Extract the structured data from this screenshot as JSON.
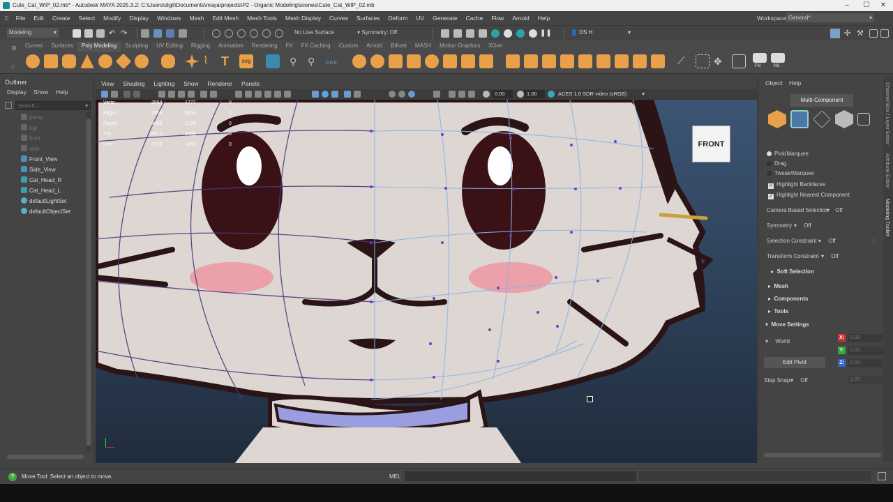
{
  "titlebar": {
    "title": "Cute_Cat_WIP_02.mb* - Autodesk MAYA 2025.3.2: C:\\Users\\digit\\Documents\\maya\\projects\\P2 - Organic Modeling\\scenes\\Cute_Cat_WIP_02.mb"
  },
  "menubar": {
    "items": [
      "File",
      "Edit",
      "Create",
      "Select",
      "Modify",
      "Display",
      "Windows",
      "Mesh",
      "Edit Mesh",
      "Mesh Tools",
      "Mesh Display",
      "Curves",
      "Surfaces",
      "Deform",
      "UV",
      "Generate",
      "Cache",
      "Flow",
      "Arnold",
      "Help"
    ],
    "workspace_label": "Workspace:",
    "workspace_value": "General*"
  },
  "statusline": {
    "menuset": "Modeling",
    "live_surface": "No Live Surface",
    "symmetry": "Symmetry: Off",
    "user": "DS H"
  },
  "shelf": {
    "tabs": [
      "Curves",
      "Surfaces",
      "Poly Modeling",
      "Sculpting",
      "UV Editing",
      "Rigging",
      "Animation",
      "Rendering",
      "FX",
      "FX Caching",
      "Custom",
      "Arnold",
      "Bifrost",
      "MASH",
      "Motion Graphics",
      "XGen"
    ],
    "active_tab": "Poly Modeling",
    "icon_labels": {
      "fn": "FN",
      "ns": "NS",
      "num": "0.0.0"
    }
  },
  "outliner": {
    "title": "Outliner",
    "menu": [
      "Display",
      "Show",
      "Help"
    ],
    "search_placeholder": "Search...",
    "items": [
      {
        "label": "persp",
        "dim": true
      },
      {
        "label": "top",
        "dim": true
      },
      {
        "label": "front",
        "dim": true
      },
      {
        "label": "side",
        "dim": true
      },
      {
        "label": "Front_View",
        "dim": false
      },
      {
        "label": "Side_View",
        "dim": false
      },
      {
        "label": "Cat_Head_R",
        "dim": false
      },
      {
        "label": "Cat_Head_L",
        "dim": false
      },
      {
        "label": "defaultLightSet",
        "dim": false
      },
      {
        "label": "defaultObjectSet",
        "dim": false
      }
    ]
  },
  "viewport": {
    "menu": [
      "View",
      "Shading",
      "Lighting",
      "Show",
      "Renderer",
      "Panels"
    ],
    "exposure": "0.00",
    "gamma": "1.00",
    "colorspace": "ACES 1.0 SDR-video (sRGB)",
    "camera_label": "front -Z",
    "view_cube": "FRONT",
    "hud": [
      {
        "label": "Verts:",
        "a": "3554",
        "b": "1777",
        "c": "0"
      },
      {
        "label": "Edges:",
        "a": "7008",
        "b": "3504",
        "c": "0"
      },
      {
        "label": "Faces:",
        "a": "3456",
        "b": "1728",
        "c": "0"
      },
      {
        "label": "Tris:",
        "a": "6912",
        "b": "3456",
        "c": "0"
      },
      {
        "label": "UVs:",
        "a": "3722",
        "b": "1861",
        "c": "0"
      }
    ]
  },
  "modeling_toolkit": {
    "tabs": [
      "Object",
      "Help"
    ],
    "mode": "Multi-Component",
    "pick_marquee": "Pick/Marquee",
    "drag": "Drag",
    "tweak_marquee": "Tweak/Marquee",
    "highlight_backfaces": "Highlight Backfaces",
    "highlight_nearest": "Highlight Nearest Component",
    "camera_based_selection": "Camera Based Selection",
    "camera_based_value": "Off",
    "symmetry": "Symmetry",
    "symmetry_value": "Off",
    "selection_constraint": "Selection Constraint",
    "selection_constraint_value": "Off",
    "selection_constraint_num": "0",
    "transform_constraint": "Transform Constraint",
    "transform_constraint_value": "Off",
    "sections": [
      "Soft Selection",
      "Mesh",
      "Components",
      "Tools",
      "Move Settings"
    ],
    "space": "World",
    "axes": [
      "X:",
      "Y:",
      "Z:"
    ],
    "axis_values": [
      "0.00",
      "0.00",
      "0.00"
    ],
    "edit_pivot": "Edit Pivot",
    "step_snap": "Step Snap:",
    "step_snap_value": "Off",
    "step_snap_num": "1.00"
  },
  "side_tabs": [
    "Channel Box / Layer Editor",
    "Attribute Editor",
    "Modeling Toolkit"
  ],
  "helpline": {
    "text": "Move Tool: Select an object to move.",
    "mel": "MEL"
  }
}
